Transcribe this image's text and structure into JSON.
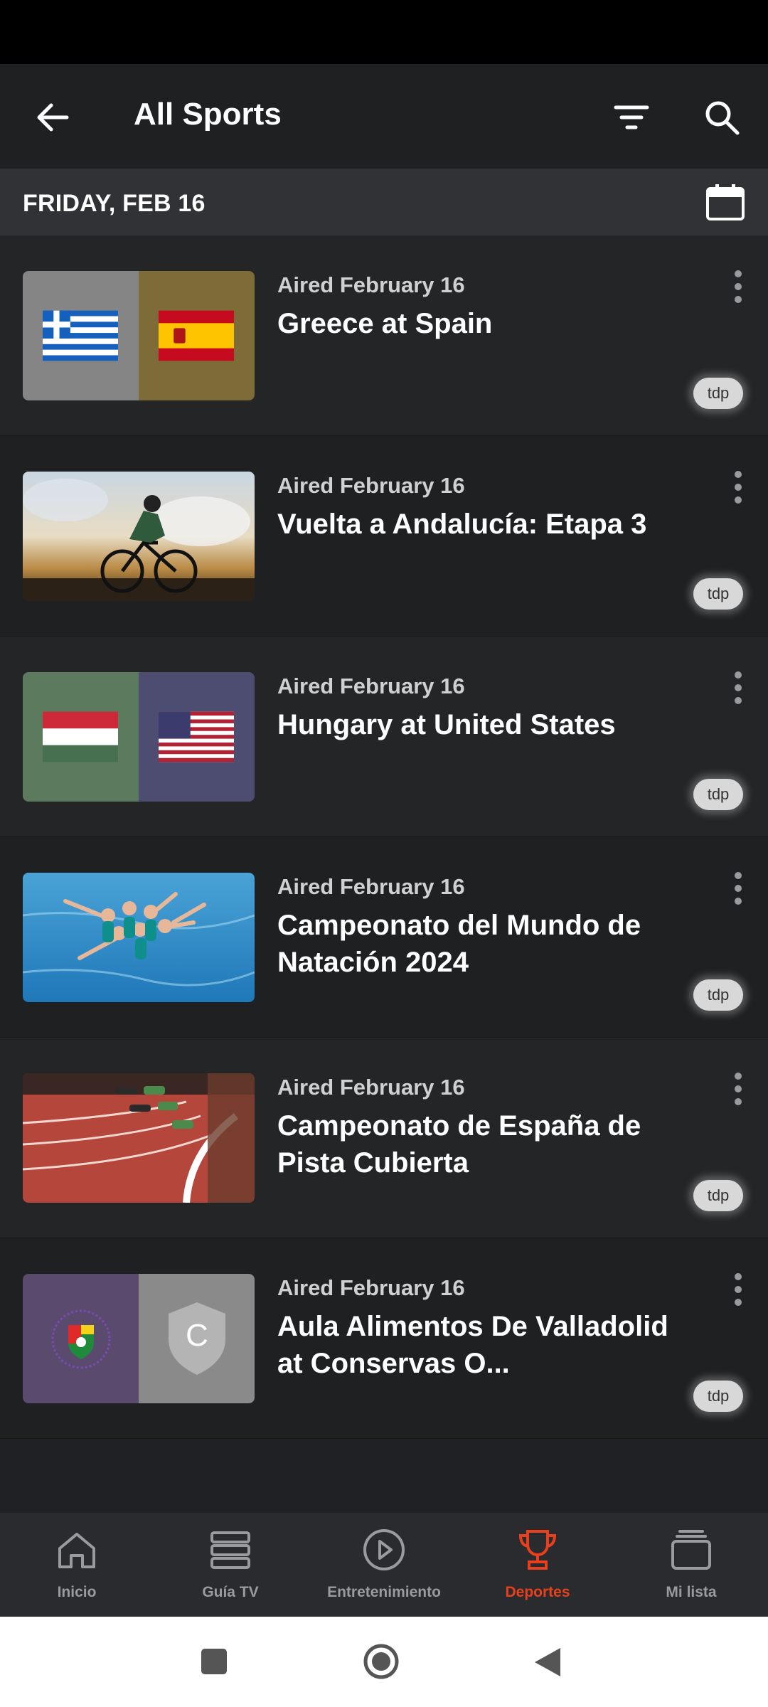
{
  "header": {
    "title": "All Sports"
  },
  "date_bar": {
    "label": "FRIDAY, FEB 16"
  },
  "items": [
    {
      "aired": "Aired February 16",
      "title": "Greece at Spain",
      "badge": "tdp"
    },
    {
      "aired": "Aired February 16",
      "title": "Vuelta a Andalucía: Etapa 3",
      "badge": "tdp"
    },
    {
      "aired": "Aired February 16",
      "title": "Hungary at United States",
      "badge": "tdp"
    },
    {
      "aired": "Aired February 16",
      "title": "Campeonato del Mundo de Natación 2024",
      "badge": "tdp"
    },
    {
      "aired": "Aired February 16",
      "title": "Campeonato de España de Pista Cubierta",
      "badge": "tdp"
    },
    {
      "aired": "Aired February 16",
      "title": "Aula Alimentos De Valladolid at Conservas O...",
      "badge": "tdp",
      "thumb_letter": "C"
    }
  ],
  "nav": [
    {
      "label": "Inicio",
      "icon": "home-icon"
    },
    {
      "label": "Guía TV",
      "icon": "tv-guide-icon"
    },
    {
      "label": "Entretenimiento",
      "icon": "play-icon"
    },
    {
      "label": "Deportes",
      "icon": "trophy-icon",
      "active": true
    },
    {
      "label": "Mi lista",
      "icon": "list-icon"
    }
  ],
  "colors": {
    "accent": "#e8401c",
    "background": "#202124"
  }
}
